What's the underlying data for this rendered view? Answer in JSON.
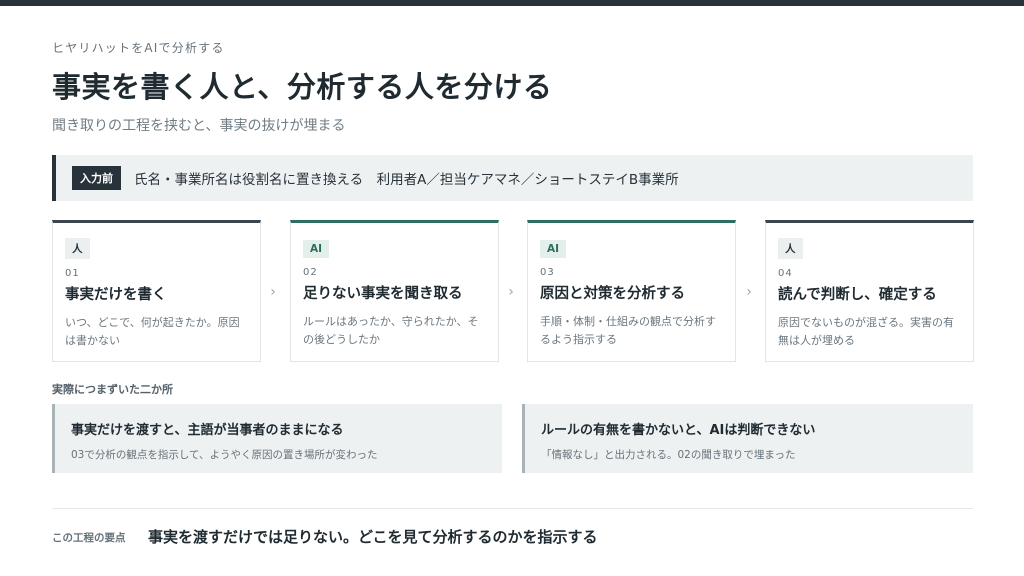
{
  "header": {
    "eyebrow": "ヒヤリハットをAIで分析する",
    "title": "事実を書く人と、分析する人を分ける",
    "subtitle": "聞き取りの工程を挟むと、事実の抜けが埋まる"
  },
  "input_bar": {
    "tag": "入力前",
    "text": "氏名・事業所名は役割名に置き換える　利用者A／担当ケアマネ／ショートステイB事業所"
  },
  "steps": [
    {
      "badge": "人",
      "number": "01",
      "title": "事実だけを書く",
      "desc": "いつ、どこで、何が起きたか。原因は書かない"
    },
    {
      "badge": "AI",
      "number": "02",
      "title": "足りない事実を聞き取る",
      "desc": "ルールはあったか、守られたか、その後どうしたか"
    },
    {
      "badge": "AI",
      "number": "03",
      "title": "原因と対策を分析する",
      "desc": "手順・体制・仕組みの観点で分析するよう指示する"
    },
    {
      "badge": "人",
      "number": "04",
      "title": "読んで判断し、確定する",
      "desc": "原因でないものが混ざる。実害の有無は人が埋める"
    }
  ],
  "arrow_glyph": "›",
  "issues_section": {
    "label": "実際につまずいた二か所",
    "items": [
      {
        "title": "事実だけを渡すと、主語が当事者のままになる",
        "desc": "03で分析の観点を指示して、ようやく原因の置き場所が変わった"
      },
      {
        "title": "ルールの有無を書かないと、AIは判断できない",
        "desc": "「情報なし」と出力される。02の聞き取りで埋まった"
      }
    ]
  },
  "footer": {
    "label": "この工程の要点",
    "text": "事実を渡すだけでは足りない。どこを見て分析するのかを指示する"
  },
  "colors": {
    "dark": "#27323a",
    "ai_accent": "#2e6e60",
    "panel_bg": "#eef1f2"
  }
}
